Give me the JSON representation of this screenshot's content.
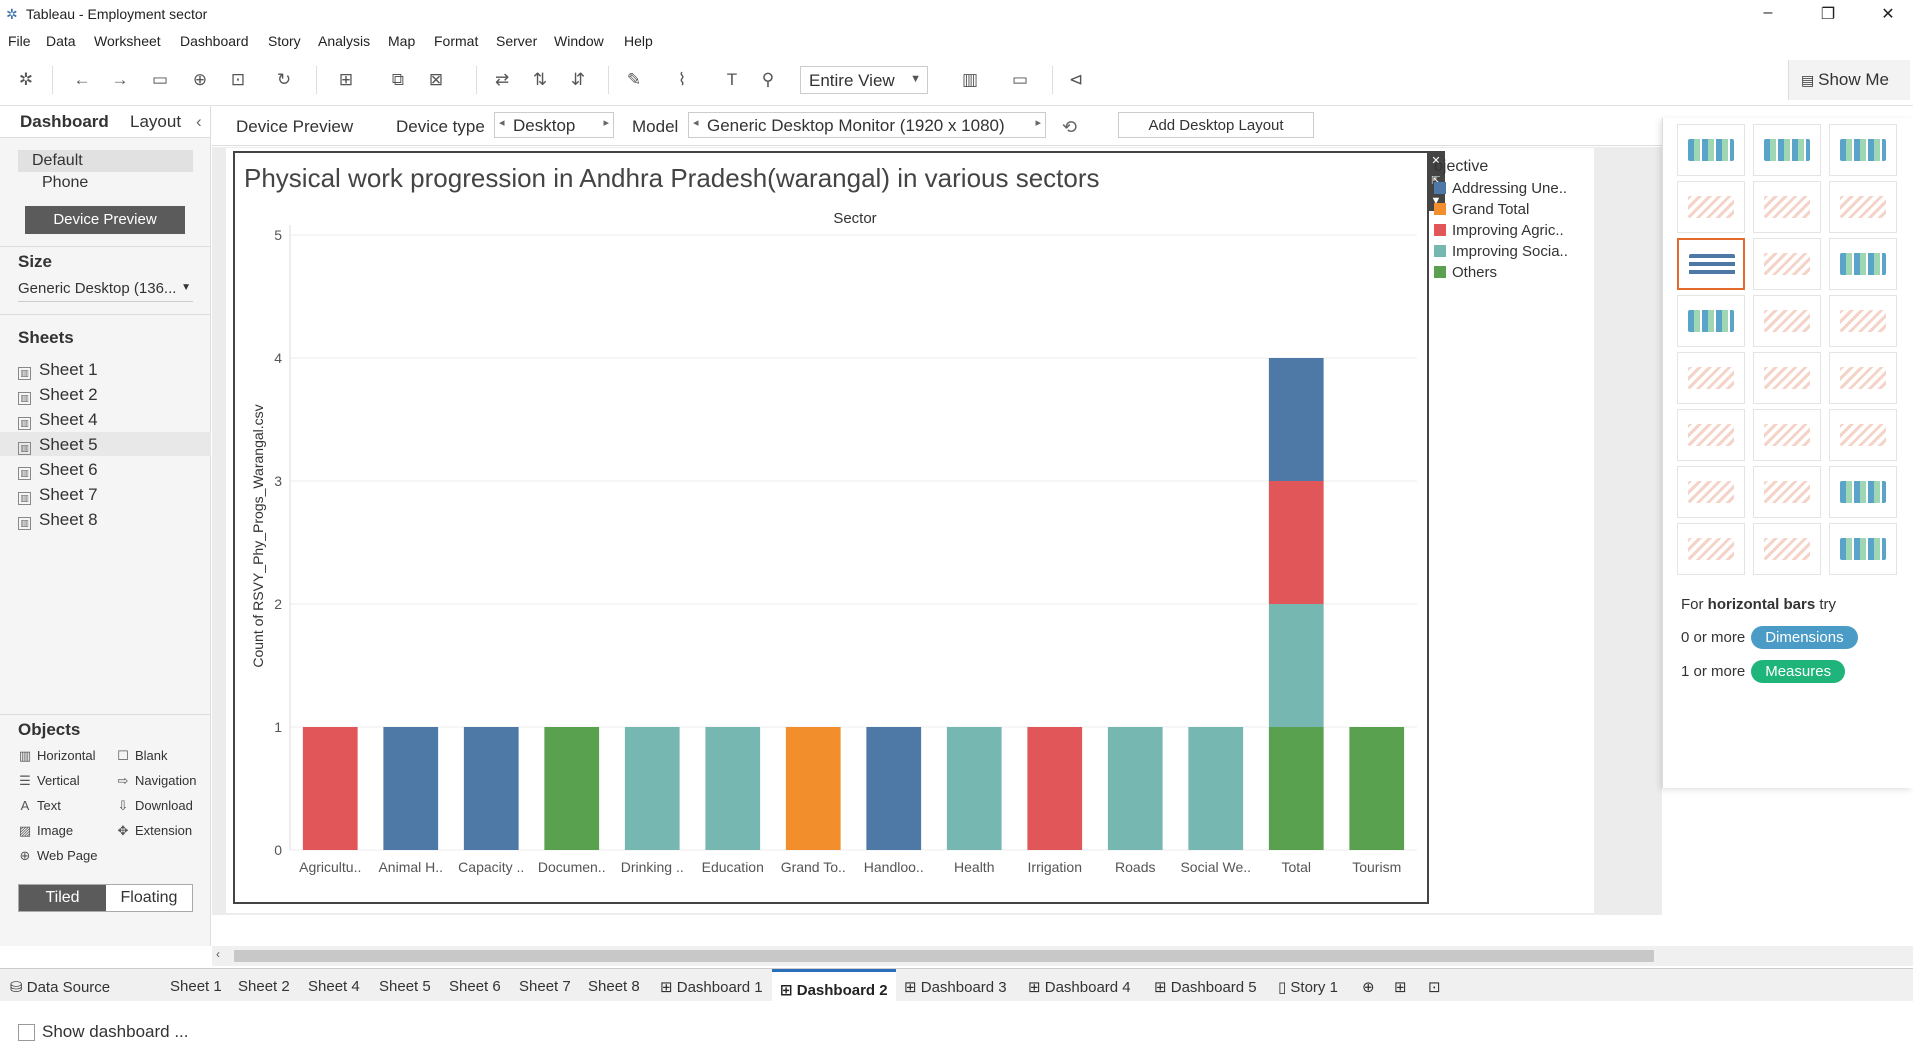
{
  "window": {
    "title": "Tableau - Employment sector"
  },
  "menu": [
    "File",
    "Data",
    "Worksheet",
    "Dashboard",
    "Story",
    "Analysis",
    "Map",
    "Format",
    "Server",
    "Window",
    "Help"
  ],
  "toolbar": {
    "view_select": "Entire View",
    "show_me_label": "Show Me"
  },
  "left_panel": {
    "tabs": [
      "Dashboard",
      "Layout"
    ],
    "devices": [
      "Default",
      "Phone"
    ],
    "device_preview_button": "Device Preview",
    "size_heading": "Size",
    "size_value": "Generic Desktop (136...",
    "sheets_heading": "Sheets",
    "sheets": [
      "Sheet 1",
      "Sheet 2",
      "Sheet 4",
      "Sheet 5",
      "Sheet 6",
      "Sheet 7",
      "Sheet 8"
    ],
    "objects_heading": "Objects",
    "objects": [
      {
        "label": "Horizontal",
        "icon": "horizontal-icon"
      },
      {
        "label": "Blank",
        "icon": "blank-icon"
      },
      {
        "label": "Vertical",
        "icon": "vertical-icon"
      },
      {
        "label": "Navigation",
        "icon": "navigation-icon"
      },
      {
        "label": "Text",
        "icon": "text-icon"
      },
      {
        "label": "Download",
        "icon": "download-icon"
      },
      {
        "label": "Image",
        "icon": "image-icon"
      },
      {
        "label": "Extension",
        "icon": "extension-icon"
      },
      {
        "label": "Web Page",
        "icon": "web-page-icon"
      }
    ],
    "tiled": "Tiled",
    "floating": "Floating",
    "show_dashboard_title": "Show dashboard ..."
  },
  "device_bar": {
    "device_preview": "Device Preview",
    "device_type_label": "Device type",
    "device_type_value": "Desktop",
    "model_label": "Model",
    "model_value": "Generic Desktop Monitor (1920 x 1080)",
    "add_layout": "Add Desktop Layout"
  },
  "legend": {
    "title": "ojective",
    "items": [
      {
        "label": "Addressing Une..",
        "color": "#4e79a7"
      },
      {
        "label": "Grand Total",
        "color": "#f28e2b"
      },
      {
        "label": "Improving Agric..",
        "color": "#e15759"
      },
      {
        "label": "Improving Socia..",
        "color": "#76b7b2"
      },
      {
        "label": "Others",
        "color": "#59a14f"
      }
    ]
  },
  "chart_data": {
    "type": "bar",
    "stacked": true,
    "title": "Physical work progression in  Andhra Pradesh(warangal) in various sectors",
    "column_header": "Sector",
    "ylabel": "Count of RSVY_Phy_Progs_Warangal.csv",
    "ylim": [
      0,
      5
    ],
    "yticks": [
      0,
      1,
      2,
      3,
      4,
      5
    ],
    "categories": [
      "Agricultu..",
      "Animal H..",
      "Capacity ..",
      "Documen..",
      "Drinking ..",
      "Education",
      "Grand To..",
      "Handloo..",
      "Health",
      "Irrigation",
      "Roads",
      "Social We..",
      "Total",
      "Tourism"
    ],
    "series": [
      {
        "name": "Others",
        "color": "#59a14f",
        "values": [
          0,
          0,
          0,
          1,
          0,
          0,
          0,
          0,
          0,
          0,
          0,
          0,
          1,
          1
        ]
      },
      {
        "name": "Improving Socia..",
        "color": "#76b7b2",
        "values": [
          0,
          0,
          0,
          0,
          1,
          1,
          0,
          0,
          1,
          0,
          1,
          1,
          1,
          0
        ]
      },
      {
        "name": "Improving Agric..",
        "color": "#e15759",
        "values": [
          1,
          0,
          0,
          0,
          0,
          0,
          0,
          0,
          0,
          1,
          0,
          0,
          1,
          0
        ]
      },
      {
        "name": "Grand Total",
        "color": "#f28e2b",
        "values": [
          0,
          0,
          0,
          0,
          0,
          0,
          1,
          0,
          0,
          0,
          0,
          0,
          0,
          0
        ]
      },
      {
        "name": "Addressing Une..",
        "color": "#4e79a7",
        "values": [
          0,
          1,
          1,
          0,
          0,
          0,
          0,
          1,
          0,
          0,
          0,
          0,
          1,
          0
        ]
      }
    ],
    "grid": true,
    "legend_position": "right"
  },
  "show_me": {
    "hint_prefix": "For",
    "hint_bold": "horizontal bars",
    "hint_suffix": "try",
    "dim_prefix": "0 or more",
    "dim_label": "Dimensions",
    "meas_prefix": "1 or more",
    "meas_label": "Measures",
    "dim_color": "#4a9cc7",
    "meas_color": "#1fb47a"
  },
  "bottom_tabs": [
    "Data Source",
    "Sheet 1",
    "Sheet 2",
    "Sheet 4",
    "Sheet 5",
    "Sheet 6",
    "Sheet 7",
    "Sheet 8",
    "Dashboard 1",
    "Dashboard 2",
    "Dashboard 3",
    "Dashboard 4",
    "Dashboard 5",
    "Story 1"
  ],
  "active_bottom_tab": "Dashboard 2"
}
